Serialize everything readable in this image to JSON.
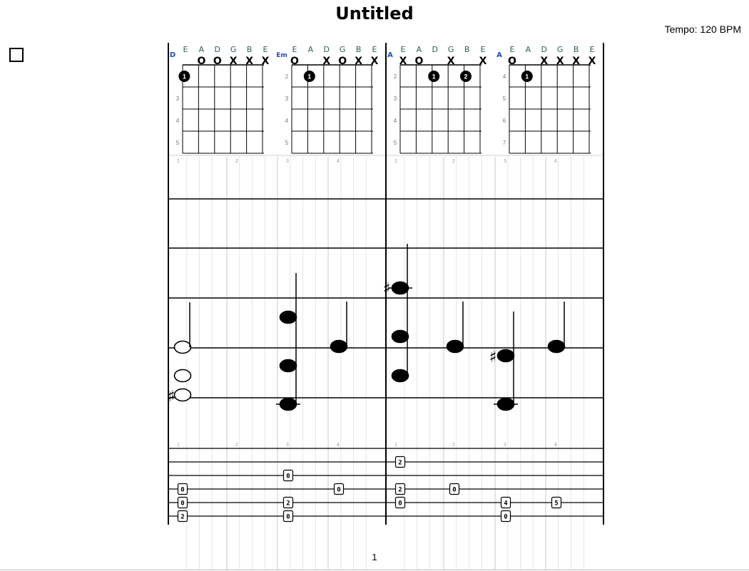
{
  "title": "Untitled",
  "tempo": "Tempo: 120 BPM",
  "page_number": "1",
  "colors": {
    "chord_name": "#1f4fb8",
    "string_label": "#2f5d5d",
    "staff": "#000000",
    "beat_grid": "#c8c8c8"
  },
  "chords": [
    {
      "name": "D",
      "strings": [
        "E",
        "A",
        "D",
        "G",
        "B",
        "E"
      ],
      "markers": [
        "",
        "O",
        "O",
        "X",
        "X",
        "X"
      ],
      "frets": [
        "",
        "3",
        "4",
        "5"
      ],
      "fingers": [
        {
          "string": 1,
          "fret_row": 1,
          "label": "1"
        }
      ]
    },
    {
      "name": "Em",
      "strings": [
        "E",
        "A",
        "D",
        "G",
        "B",
        "E"
      ],
      "markers": [
        "O",
        "",
        "X",
        "O",
        "X",
        "X"
      ],
      "frets": [
        "2",
        "3",
        "4",
        "5"
      ],
      "fingers": [
        {
          "string": 2,
          "fret_row": 1,
          "label": "1"
        }
      ]
    },
    {
      "name": "A",
      "strings": [
        "E",
        "A",
        "D",
        "G",
        "B",
        "E"
      ],
      "markers": [
        "X",
        "O",
        "",
        "X",
        "",
        "X"
      ],
      "frets": [
        "2",
        "3",
        "4",
        "5"
      ],
      "fingers": [
        {
          "string": 3,
          "fret_row": 1,
          "label": "1"
        },
        {
          "string": 5,
          "fret_row": 1,
          "label": "2"
        }
      ]
    },
    {
      "name": "A",
      "strings": [
        "E",
        "A",
        "D",
        "G",
        "B",
        "E"
      ],
      "markers": [
        "O",
        "",
        "X",
        "X",
        "X",
        "X"
      ],
      "frets": [
        "4",
        "5",
        "6",
        "7"
      ],
      "fingers": [
        {
          "string": 2,
          "fret_row": 1,
          "label": "1"
        }
      ]
    }
  ],
  "beat_numbers": [
    "1",
    "2",
    "3",
    "4",
    "1",
    "2",
    "3",
    "4"
  ],
  "tab": [
    {
      "beat": 0,
      "frets": [
        {
          "line": 3,
          "label": "0"
        },
        {
          "line": 4,
          "label": "0"
        },
        {
          "line": 5,
          "label": "2"
        }
      ]
    },
    {
      "beat": 2,
      "frets": [
        {
          "line": 2,
          "label": "0"
        },
        {
          "line": 4,
          "label": "2"
        },
        {
          "line": 5,
          "label": "0"
        }
      ]
    },
    {
      "beat": 3,
      "frets": [
        {
          "line": 3,
          "label": "0"
        }
      ]
    },
    {
      "beat": 4,
      "frets": [
        {
          "line": 1,
          "label": "2"
        },
        {
          "line": 3,
          "label": "2"
        },
        {
          "line": 4,
          "label": "0"
        }
      ]
    },
    {
      "beat": 5,
      "frets": [
        {
          "line": 3,
          "label": "0"
        }
      ]
    },
    {
      "beat": 6,
      "frets": [
        {
          "line": 4,
          "label": "4"
        },
        {
          "line": 5,
          "label": "0"
        }
      ]
    },
    {
      "beat": 7,
      "frets": [
        {
          "line": 4,
          "label": "5"
        }
      ]
    }
  ]
}
